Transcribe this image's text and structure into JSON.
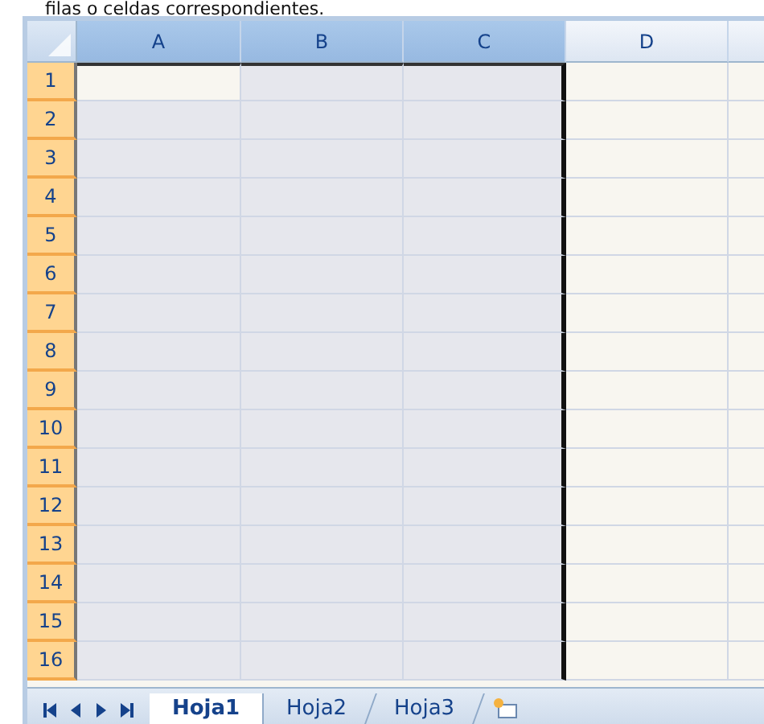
{
  "caption": "filas o celdas correspondientes.",
  "columns": [
    {
      "label": "A",
      "selected": true
    },
    {
      "label": "B",
      "selected": true
    },
    {
      "label": "C",
      "selected": true
    },
    {
      "label": "D",
      "selected": false
    }
  ],
  "rows": [
    {
      "label": "1",
      "selected": true
    },
    {
      "label": "2",
      "selected": true
    },
    {
      "label": "3",
      "selected": true
    },
    {
      "label": "4",
      "selected": true
    },
    {
      "label": "5",
      "selected": true
    },
    {
      "label": "6",
      "selected": true
    },
    {
      "label": "7",
      "selected": true
    },
    {
      "label": "8",
      "selected": true
    },
    {
      "label": "9",
      "selected": true
    },
    {
      "label": "10",
      "selected": true
    },
    {
      "label": "11",
      "selected": true
    },
    {
      "label": "12",
      "selected": true
    },
    {
      "label": "13",
      "selected": true
    },
    {
      "label": "14",
      "selected": true
    },
    {
      "label": "15",
      "selected": true
    },
    {
      "label": "16",
      "selected": true
    }
  ],
  "sheet_tabs": [
    {
      "label": "Hoja1",
      "selected": true
    },
    {
      "label": "Hoja2",
      "selected": false
    },
    {
      "label": "Hoja3",
      "selected": false
    }
  ]
}
